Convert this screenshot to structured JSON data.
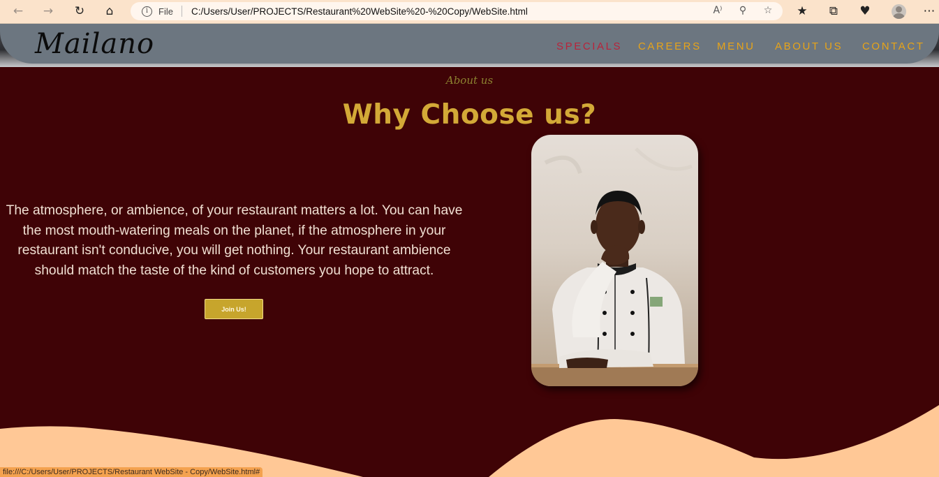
{
  "browser": {
    "nav_icons": [
      "back-arrow-icon",
      "forward-arrow-icon",
      "refresh-icon",
      "home-icon"
    ],
    "address_bar": {
      "scheme_label": "File",
      "url": "C:/Users/User/PROJECTS/Restaurant%20WebSite%20-%20Copy/WebSite.html",
      "icons": [
        "read-aloud-icon",
        "zoom-out-icon",
        "add-favorite-icon"
      ]
    },
    "toolbar_icons": [
      "favorites-icon",
      "collections-icon",
      "health-icon",
      "profile-icon",
      "more-icon"
    ],
    "status_text": "file:///C:/Users/User/PROJECTS/Restaurant WebSite - Copy/WebSite.html#"
  },
  "site": {
    "logo": "Mailano",
    "nav": [
      {
        "label": "SPECIALS",
        "active": true
      },
      {
        "label": "CAREERS",
        "active": false
      },
      {
        "label": "MENU",
        "active": false
      },
      {
        "label": "ABOUT US",
        "active": false
      },
      {
        "label": "CONTACT",
        "active": false
      }
    ],
    "colors": {
      "background": "#3f0306",
      "accent": "#d3a937",
      "nav_text": "#e8a418",
      "nav_active": "#b9233a",
      "wave": "#ffc896"
    }
  },
  "about": {
    "kicker": "About us",
    "heading": "Why Choose us?",
    "body": "The atmosphere, or ambience, of your restaurant matters a lot. You can have the most mouth-watering meals on the planet, if the atmosphere in your restaurant isn't conducive, you will get nothing. Your restaurant ambience should match the taste of the kind of customers you hope to attract.",
    "button_label": "Join Us!",
    "image_alt": "chef portrait"
  }
}
